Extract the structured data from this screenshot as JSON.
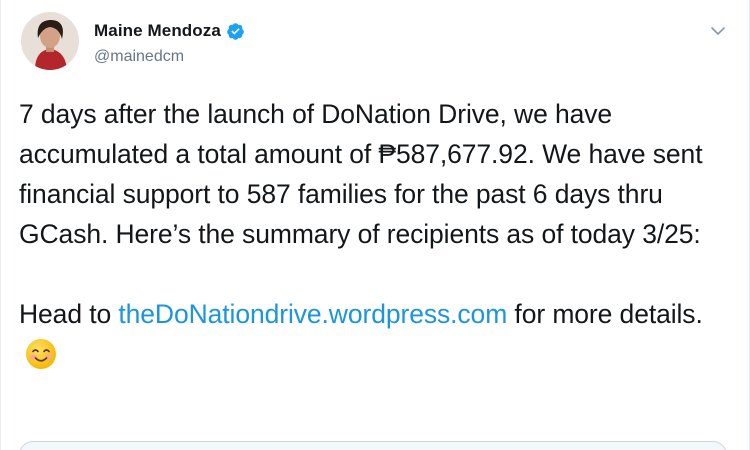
{
  "author": {
    "display_name": "Maine Mendoza",
    "handle": "@mainedcm",
    "verified": true,
    "avatar_icon": "profile-avatar"
  },
  "tweet": {
    "body_line_1": "7 days after the launch of DoNation Drive, we have accumulated a total amount of ₱587,677.92. We have sent financial support to 587 families for the past 6 days thru GCash. Here’s the summary of recipients as of today 3/25:",
    "body_line_2_prefix": "Head to ",
    "link_text": "theDoNationdrive.wordpress.com",
    "body_line_2_suffix": " for more details.",
    "emoji": "smiling-face-with-smiling-eyes"
  },
  "icons": {
    "verified": "verified-badge-icon",
    "caret": "chevron-down-icon"
  },
  "colors": {
    "text": "#14171a",
    "secondary": "#657786",
    "link": "#1b95e0",
    "verified": "#1da1f2"
  }
}
